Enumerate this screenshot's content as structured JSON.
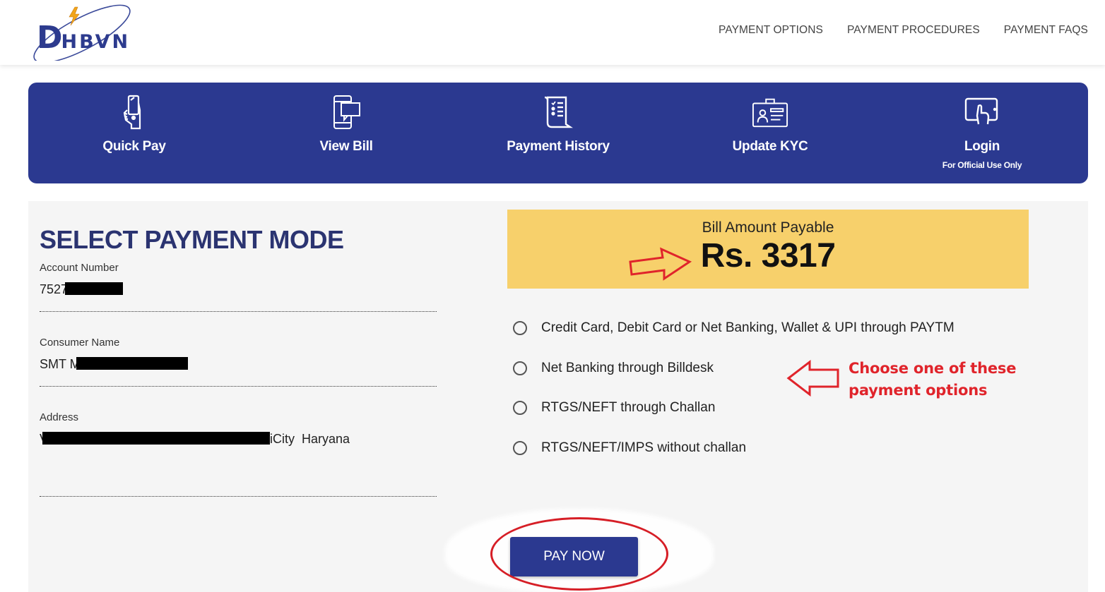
{
  "header": {
    "logo_initial": "D",
    "logo_rest": "HBVN",
    "nav": [
      "PAYMENT OPTIONS",
      "PAYMENT PROCEDURES",
      "PAYMENT FAQS"
    ]
  },
  "quicknav": [
    {
      "label": "Quick Pay",
      "icon": "hand-phone-icon"
    },
    {
      "label": "View Bill",
      "icon": "phone-message-icon"
    },
    {
      "label": "Payment History",
      "icon": "receipt-scroll-icon"
    },
    {
      "label": "Update KYC",
      "icon": "id-card-icon"
    },
    {
      "label": "Login",
      "sub": "For Official Use Only",
      "icon": "tablet-touch-icon"
    }
  ],
  "form": {
    "title": "SELECT PAYMENT MODE",
    "fields": [
      {
        "label": "Account Number",
        "value_prefix": "7527",
        "value_suffix": ""
      },
      {
        "label": "Consumer Name",
        "value_prefix": "SMT M",
        "value_suffix": ""
      },
      {
        "label": "Address",
        "value_prefix": "V",
        "value_suffix": "iCity  Haryana"
      }
    ]
  },
  "bill": {
    "label": "Bill Amount Payable",
    "amount": "Rs. 3317"
  },
  "payment_options": [
    "Credit Card, Debit Card or Net Banking, Wallet & UPI through PAYTM",
    "Net Banking through Billdesk",
    "RTGS/NEFT through Challan",
    "RTGS/NEFT/IMPS without challan"
  ],
  "annotation": {
    "line1": "Choose one of these",
    "line2": "payment options",
    "color": "#e0242b"
  },
  "pay_button": "PAY NOW",
  "colors": {
    "brand_blue": "#2b3990",
    "amount_bg": "#f7d06b",
    "title_color": "#2b3471"
  }
}
